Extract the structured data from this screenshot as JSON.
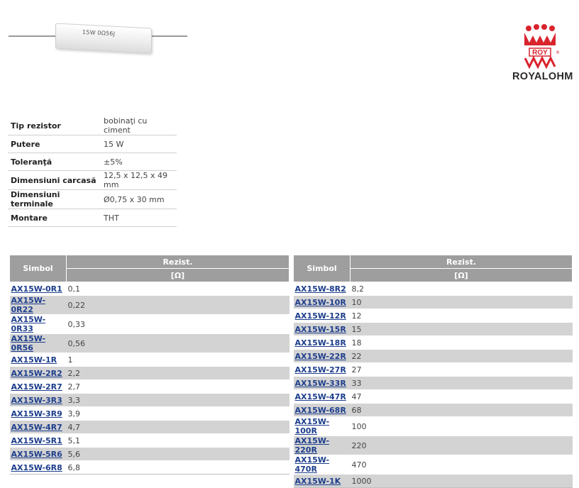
{
  "product_image": {
    "marking": "15W 0Ω56J"
  },
  "logo": {
    "brand": "ROYALOHM",
    "emblem_text": "ROY",
    "icon": "royalohm-logo-icon",
    "color": "#d9232d"
  },
  "specs": [
    {
      "label": "Tip rezistor",
      "value": "bobinaţi cu ciment"
    },
    {
      "label": "Putere",
      "value": "15 W"
    },
    {
      "label": "Toleranţă",
      "value": "±5%"
    },
    {
      "label": "Dimensiuni carcasă",
      "value": "12,5 x 12,5 x 49 mm"
    },
    {
      "label": "Dimensiuni terminale",
      "value": "Ø0,75 x 30 mm"
    },
    {
      "label": "Montare",
      "value": "THT"
    }
  ],
  "table_left": {
    "header_symbol": "Simbol",
    "header_value": "Rezist.",
    "header_unit": "[Ω]",
    "rows": [
      {
        "code": "AX15W-0R1",
        "value": "0,1"
      },
      {
        "code": "AX15W-0R22",
        "value": "0,22"
      },
      {
        "code": "AX15W-0R33",
        "value": "0,33"
      },
      {
        "code": "AX15W-0R56",
        "value": "0,56"
      },
      {
        "code": "AX15W-1R",
        "value": "1"
      },
      {
        "code": "AX15W-2R2",
        "value": "2,2"
      },
      {
        "code": "AX15W-2R7",
        "value": "2,7"
      },
      {
        "code": "AX15W-3R3",
        "value": "3,3"
      },
      {
        "code": "AX15W-3R9",
        "value": "3,9"
      },
      {
        "code": "AX15W-4R7",
        "value": "4,7"
      },
      {
        "code": "AX15W-5R1",
        "value": "5,1"
      },
      {
        "code": "AX15W-5R6",
        "value": "5,6"
      },
      {
        "code": "AX15W-6R8",
        "value": "6,8"
      }
    ]
  },
  "table_right": {
    "header_symbol": "Simbol",
    "header_value": "Rezist.",
    "header_unit": "[Ω]",
    "rows": [
      {
        "code": "AX15W-8R2",
        "value": "8,2"
      },
      {
        "code": "AX15W-10R",
        "value": "10"
      },
      {
        "code": "AX15W-12R",
        "value": "12"
      },
      {
        "code": "AX15W-15R",
        "value": "15"
      },
      {
        "code": "AX15W-18R",
        "value": "18"
      },
      {
        "code": "AX15W-22R",
        "value": "22"
      },
      {
        "code": "AX15W-27R",
        "value": "27"
      },
      {
        "code": "AX15W-33R",
        "value": "33"
      },
      {
        "code": "AX15W-47R",
        "value": "47"
      },
      {
        "code": "AX15W-68R",
        "value": "68"
      },
      {
        "code": "AX15W-100R",
        "value": "100"
      },
      {
        "code": "AX15W-220R",
        "value": "220"
      },
      {
        "code": "AX15W-470R",
        "value": "470"
      },
      {
        "code": "AX15W-1K",
        "value": "1000"
      }
    ]
  }
}
